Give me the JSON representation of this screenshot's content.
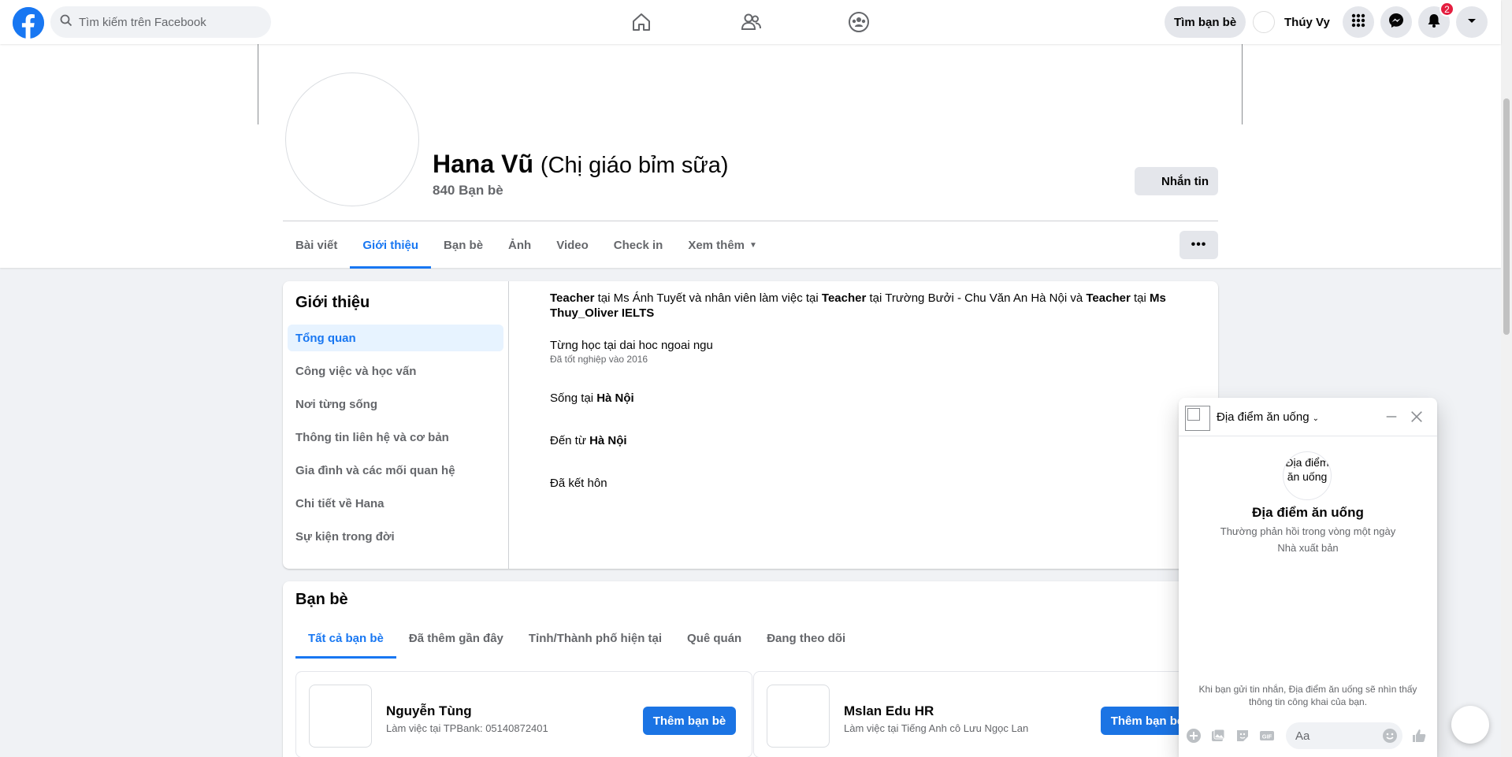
{
  "topbar": {
    "search_placeholder": "Tìm kiếm trên Facebook",
    "find_friends_label": "Tìm bạn bè",
    "user_name": "Thúy Vy",
    "notification_count": "2"
  },
  "profile": {
    "name": "Hana Vũ",
    "nickname": "(Chị giáo bỉm sữa)",
    "friends_count": "840 Bạn bè",
    "message_button": "Nhắn tin"
  },
  "tabs": [
    {
      "label": "Bài viết",
      "active": false
    },
    {
      "label": "Giới thiệu",
      "active": true
    },
    {
      "label": "Bạn bè",
      "active": false
    },
    {
      "label": "Ảnh",
      "active": false
    },
    {
      "label": "Video",
      "active": false
    },
    {
      "label": "Check in",
      "active": false
    },
    {
      "label": "Xem thêm",
      "active": false
    }
  ],
  "more_button": "•••",
  "about": {
    "title": "Giới thiệu",
    "menu": [
      {
        "label": "Tổng quan",
        "active": true
      },
      {
        "label": "Công việc và học vấn",
        "active": false
      },
      {
        "label": "Nơi từng sống",
        "active": false
      },
      {
        "label": "Thông tin liên hệ và cơ bản",
        "active": false
      },
      {
        "label": "Gia đình và các mối quan hệ",
        "active": false
      },
      {
        "label": "Chi tiết về Hana",
        "active": false
      },
      {
        "label": "Sự kiện trong đời",
        "active": false
      }
    ],
    "work": {
      "t1": "Teacher",
      "t2": " tại Ms Ánh Tuyết và nhân viên làm việc tại ",
      "t3": "Teacher",
      "t4": " tại Trường Bưởi - Chu Văn An Hà Nội và ",
      "t5": "Teacher",
      "t6": " tại ",
      "t7": "Ms Thuy_Oliver IELTS"
    },
    "education": {
      "text": "Từng học tại dai hoc ngoai ngu",
      "sub": "Đã tốt nghiệp vào 2016"
    },
    "lives": {
      "prefix": "Sống tại ",
      "place": "Hà Nội"
    },
    "from": {
      "prefix": "Đến từ ",
      "place": "Hà Nội"
    },
    "relationship": "Đã kết hôn"
  },
  "friends": {
    "title": "Bạn bè",
    "tabs": [
      {
        "label": "Tất cả bạn bè",
        "active": true
      },
      {
        "label": "Đã thêm gần đây",
        "active": false
      },
      {
        "label": "Tỉnh/Thành phố hiện tại",
        "active": false
      },
      {
        "label": "Quê quán",
        "active": false
      },
      {
        "label": "Đang theo dõi",
        "active": false
      }
    ],
    "items": [
      {
        "name": "Nguyễn Tùng",
        "desc": "Làm việc tại TPBank: 05140872401",
        "button": "Thêm bạn bè"
      },
      {
        "name": "Mslan Edu HR",
        "desc": "Làm việc tại Tiếng Anh cô Lưu Ngọc Lan",
        "button": "Thêm bạn bè"
      }
    ]
  },
  "chat": {
    "header_name": "Địa điểm ăn uống",
    "pic_alt": "Địa điểm ăn uống",
    "name": "Địa điểm ăn uống",
    "status": "Thường phản hồi trong vòng một ngày",
    "role": "Nhà xuất bản",
    "notice": "Khi bạn gửi tin nhắn, Địa điểm ăn uống sẽ nhìn thấy thông tin công khai của bạn.",
    "input_placeholder": "Aa"
  },
  "colors": {
    "accent": "#1877f2",
    "badge": "#e41e3f",
    "muted": "#65676b",
    "background": "#f0f2f5"
  }
}
